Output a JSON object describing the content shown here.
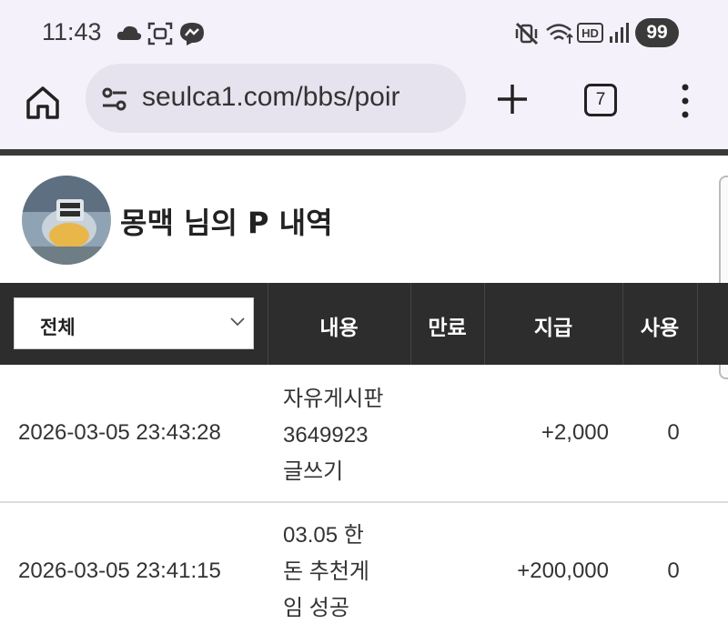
{
  "status_bar": {
    "time": "11:43",
    "battery": "99",
    "icons": [
      "cloud-icon",
      "screen-capture-icon",
      "messenger-icon",
      "mute-vibrate-icon",
      "wifi-icon",
      "hd-icon",
      "signal-icon"
    ]
  },
  "browser": {
    "url": "seulca1.com/bbs/poir",
    "tab_count": "7"
  },
  "page": {
    "title": "몽맥 님의 P 내역"
  },
  "table": {
    "filter": {
      "selected": "전체"
    },
    "headers": {
      "content": "내용",
      "expiry": "만료",
      "earned": "지급",
      "used": "사용"
    },
    "rows": [
      {
        "datetime": "2026-03-05 23:43:28",
        "content_lines": [
          "자유게시판",
          "3649923",
          "글쓰기"
        ],
        "expiry": "",
        "earned": "+2,000",
        "used": "0"
      },
      {
        "datetime": "2026-03-05 23:41:15",
        "content_lines": [
          "03.05 한",
          "돈 추천게",
          "임 성공"
        ],
        "expiry": "",
        "earned": "+200,000",
        "used": "0"
      }
    ]
  },
  "colors": {
    "chrome_bg": "#f4f1fb",
    "url_pill_bg": "#e6e2ee",
    "table_header_bg": "#2d2d2d",
    "text": "#222222"
  }
}
